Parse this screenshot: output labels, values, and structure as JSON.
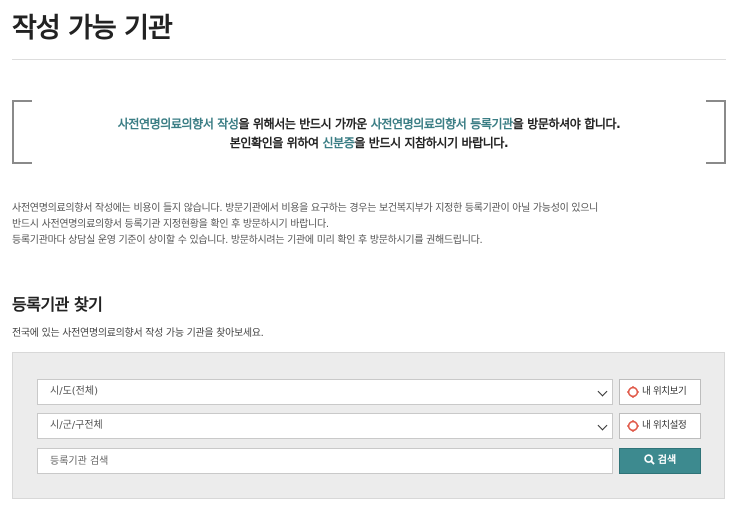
{
  "page": {
    "title": "작성 가능 기관"
  },
  "notice": {
    "line1": [
      {
        "text": "사전연명의료의향서 작성",
        "highlight": true
      },
      {
        "text": "을 위해서는 반드시 가까운 ",
        "highlight": false
      },
      {
        "text": "사전연명의료의향서 등록기관",
        "highlight": true
      },
      {
        "text": "을 방문하셔야 합니다.",
        "highlight": false
      }
    ],
    "line2": [
      {
        "text": "본인확인을 위하여 ",
        "highlight": false
      },
      {
        "text": "신분증",
        "highlight": true
      },
      {
        "text": "을 반드시 지참하시기 바랍니다.",
        "highlight": false
      }
    ]
  },
  "description": {
    "line1": "사전연명의료의향서 작성에는 비용이 들지 않습니다. 방문기관에서 비용을 요구하는 경우는 보건복지부가 지정한 등록기관이 아닐 가능성이 있으니",
    "line2": "반드시 사전연명의료의향서 등록기관 지정현황을 확인 후 방문하시기 바랍니다.",
    "line3": "등록기관마다 상담실 운영 기준이 상이할 수 있습니다. 방문하시려는 기관에 미리 확인 후 방문하시기를 권해드립니다."
  },
  "finder": {
    "title": "등록기관 찾기",
    "description": "전국에 있는 사전연명의료의향서 작성 가능 기관을 찾아보세요.",
    "region_select": {
      "value": "시/도(전체)"
    },
    "district_select": {
      "value": "시/군/구전체"
    },
    "my_location_view_label": "내 위치보기",
    "my_location_set_label": "내 위치설정",
    "keyword_placeholder": "등록기관 검색",
    "search_label": "검색"
  },
  "colors": {
    "accent": "#3a7d84",
    "search_button": "#3d8a8f",
    "location_icon": "#e05a4a"
  }
}
